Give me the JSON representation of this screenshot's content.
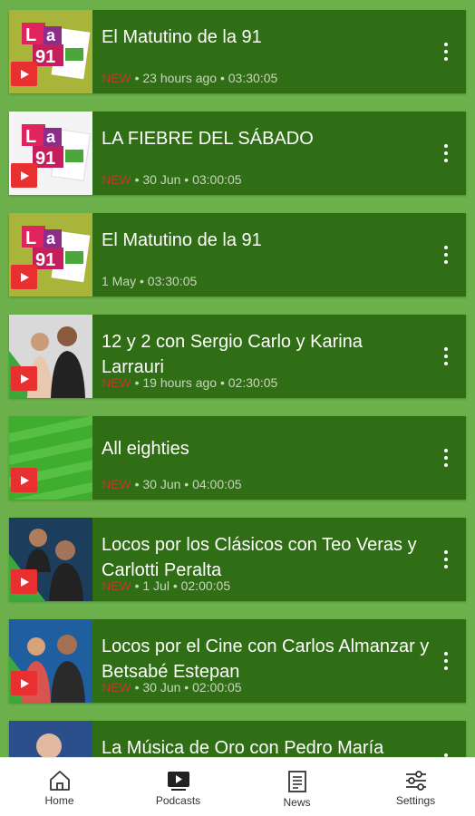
{
  "episodes": [
    {
      "title": "El Matutino de la 91",
      "badge": "NEW",
      "meta": "• 23 hours ago • 03:30:05",
      "art": "la91"
    },
    {
      "title": "LA FIEBRE DEL SÁBADO",
      "badge": "NEW",
      "meta": "• 30 Jun • 03:00:05",
      "art": "la91-white"
    },
    {
      "title": "El Matutino de la 91",
      "badge": "",
      "meta": "1 May • 03:30:05",
      "art": "la91"
    },
    {
      "title": "12 y 2 con Sergio Carlo y Karina Larrauri",
      "badge": "NEW",
      "meta": "• 19 hours ago • 02:30:05",
      "art": "hosts"
    },
    {
      "title": "All eighties",
      "badge": "NEW",
      "meta": "• 30 Jun • 04:00:05",
      "art": "weekend"
    },
    {
      "title": "Locos por los Clásicos con Teo Veras y Carlotti Peralta",
      "badge": "NEW",
      "meta": "• 1 Jul • 02:00:05",
      "art": "hosts"
    },
    {
      "title": "Locos por el Cine con Carlos Almanzar y Betsabé Estepan",
      "badge": "NEW",
      "meta": "• 30 Jun • 02:00:05",
      "art": "hosts-red"
    },
    {
      "title": "La Música de Oro con Pedro María Santos",
      "badge": "",
      "meta": "",
      "art": "hosts"
    }
  ],
  "nav": [
    {
      "label": "Home",
      "icon": "home-icon"
    },
    {
      "label": "Podcasts",
      "icon": "podcast-icon"
    },
    {
      "label": "News",
      "icon": "news-icon"
    },
    {
      "label": "Settings",
      "icon": "settings-icon"
    }
  ],
  "colors": {
    "background": "#6bb04a",
    "card": "#2f6e14",
    "badge": "#c0392b",
    "play": "#e83030"
  }
}
